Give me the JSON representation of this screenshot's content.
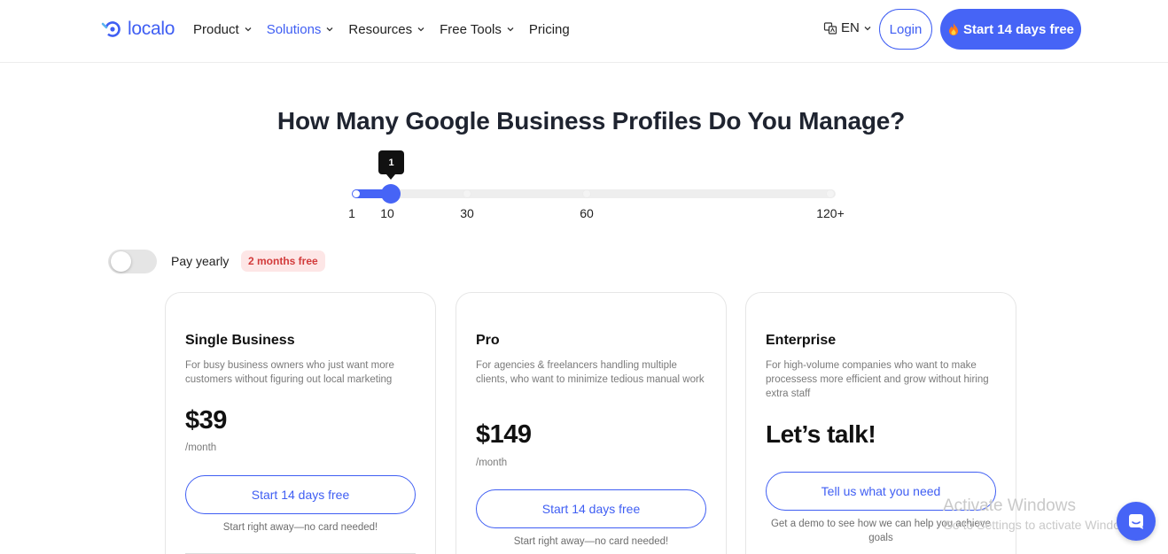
{
  "nav": {
    "logo_text": "localo",
    "items": [
      {
        "label": "Product",
        "dropdown": true
      },
      {
        "label": "Solutions",
        "dropdown": true,
        "active": true
      },
      {
        "label": "Resources",
        "dropdown": true
      },
      {
        "label": "Free Tools",
        "dropdown": true
      },
      {
        "label": "Pricing",
        "dropdown": false
      }
    ],
    "language": "EN",
    "login_label": "Login",
    "start_label": "Start 14 days free",
    "start_icon": "fire-icon"
  },
  "heading": "How Many Google Business Profiles Do You Manage?",
  "slider": {
    "tooltip_value": "1",
    "ticks": [
      "1",
      "10",
      "30",
      "60",
      "120+"
    ]
  },
  "billing": {
    "pay_yearly_label": "Pay yearly",
    "yearly_enabled": false,
    "badge": "2 months free"
  },
  "plans": [
    {
      "title": "Single Business",
      "description": "For busy business owners who just want more customers without figuring out local marketing",
      "price": "$39",
      "period": "/month",
      "button": "Start 14 days free",
      "note": "Start right away—no card needed!"
    },
    {
      "title": "Pro",
      "description": "For agencies & freelancers handling multiple clients, who want to minimize tedious manual work",
      "price": "$149",
      "period": "/month",
      "button": "Start 14 days free",
      "note": "Start right away—no card needed!"
    },
    {
      "title": "Enterprise",
      "description": "For high-volume companies who want to make processess more efficient and grow without hiring extra staff",
      "price": "Let’s talk!",
      "period": "",
      "button": "Tell us what you need",
      "note": "Get a demo to see how we can help you achieve goals"
    }
  ],
  "watermark": {
    "line1": "Activate Windows",
    "line2": "Go to Settings to activate Windows."
  },
  "colors": {
    "accent": "#4664f6",
    "badge_bg": "#fde6e6",
    "badge_text": "#d23b3b"
  }
}
